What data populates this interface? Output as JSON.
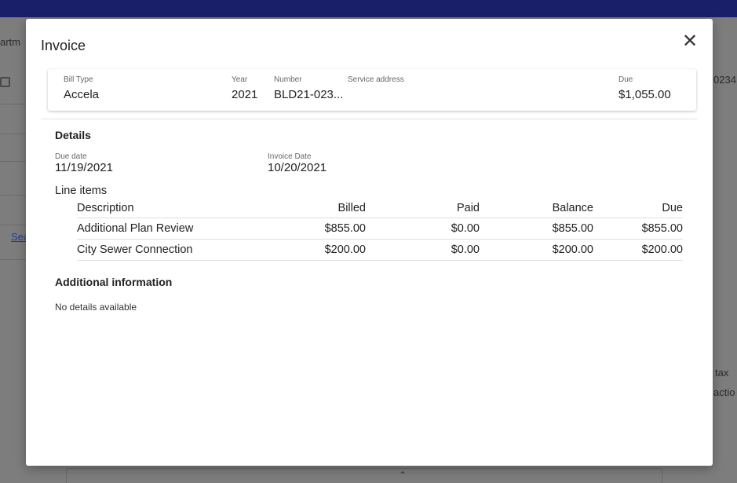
{
  "background": {
    "left_texts": [
      "artm",
      "Sea"
    ],
    "right_texts": [
      "0234",
      "tax",
      "actio"
    ]
  },
  "modal": {
    "title": "Invoice",
    "close_icon": "close-icon",
    "summary": {
      "bill_type_label": "Bill Type",
      "bill_type_value": "Accela",
      "year_label": "Year",
      "year_value": "2021",
      "number_label": "Number",
      "number_value": "BLD21-023...",
      "service_address_label": "Service address",
      "due_label": "Due",
      "due_value": "$1,055.00"
    },
    "details": {
      "heading": "Details",
      "due_date_label": "Due date",
      "due_date_value": "11/19/2021",
      "invoice_date_label": "Invoice Date",
      "invoice_date_value": "10/20/2021"
    },
    "line_items": {
      "heading": "Line items",
      "columns": [
        "Description",
        "Billed",
        "Paid",
        "Balance",
        "Due"
      ],
      "rows": [
        [
          "Additional Plan Review",
          "$855.00",
          "$0.00",
          "$855.00",
          "$855.00"
        ],
        [
          "City Sewer Connection",
          "$200.00",
          "$0.00",
          "$200.00",
          "$200.00"
        ]
      ]
    },
    "additional": {
      "heading": "Additional information",
      "text": "No details available"
    }
  }
}
